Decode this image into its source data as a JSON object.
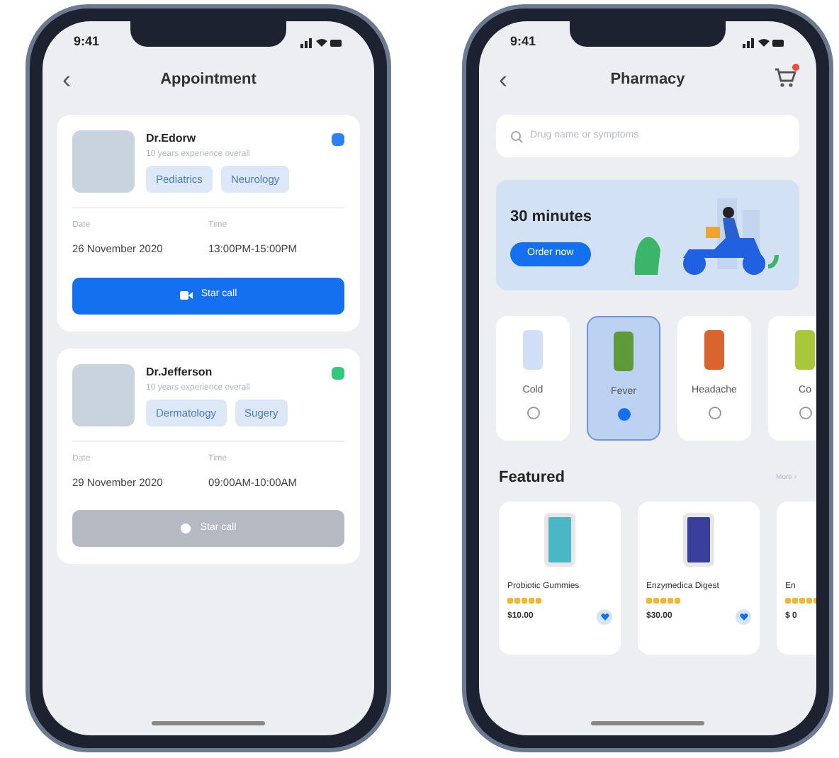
{
  "appointment_screen": {
    "status_time": "9:41",
    "back": "‹",
    "title": "Appointment",
    "cards": [
      {
        "doctor": "Dr.Edorw",
        "experience": "10 years experience overall",
        "color": "#2f80f0",
        "tags": [
          "Pediatrics",
          "Neurology"
        ],
        "date_label": "Date",
        "date": "26 November 2020",
        "time_label": "Time",
        "time": "13:00PM-15:00PM",
        "call_label": "Star call",
        "call_enabled": true
      },
      {
        "doctor": "Dr.Jefferson",
        "experience": "10 years experience overall",
        "color": "#34c77b",
        "tags": [
          "Dermatology",
          "Sugery"
        ],
        "date_label": "Date",
        "date": "29 November 2020",
        "time_label": "Time",
        "time": "09:00AM-10:00AM",
        "call_label": "Star call",
        "call_enabled": false
      }
    ]
  },
  "pharmacy_screen": {
    "status_time": "9:41",
    "back": "‹",
    "title": "Pharmacy",
    "cart_badge": true,
    "search": {
      "placeholder": "Drug name or symptoms"
    },
    "banner": {
      "title": "30 minutes",
      "button": "Order now"
    },
    "categories": [
      {
        "label": "Cold",
        "selected": false,
        "color": "#cfe0f5"
      },
      {
        "label": "Fever",
        "selected": true,
        "color": "#5f9a3a"
      },
      {
        "label": "Headache",
        "selected": false,
        "color": "#d9642e"
      },
      {
        "label": "Co",
        "selected": false,
        "color": "#a6c83a"
      }
    ],
    "featured_title": "Featured",
    "more": "More ›",
    "products": [
      {
        "name": "Probiotic Gummies",
        "stars": 5,
        "price": "$10.00",
        "color": "#49b8c4"
      },
      {
        "name": "Enzymedica Digest",
        "stars": 5,
        "price": "$30.00",
        "color": "#3b3f9c"
      },
      {
        "name": "En",
        "stars": 5,
        "price": "$ 0"
      }
    ]
  }
}
